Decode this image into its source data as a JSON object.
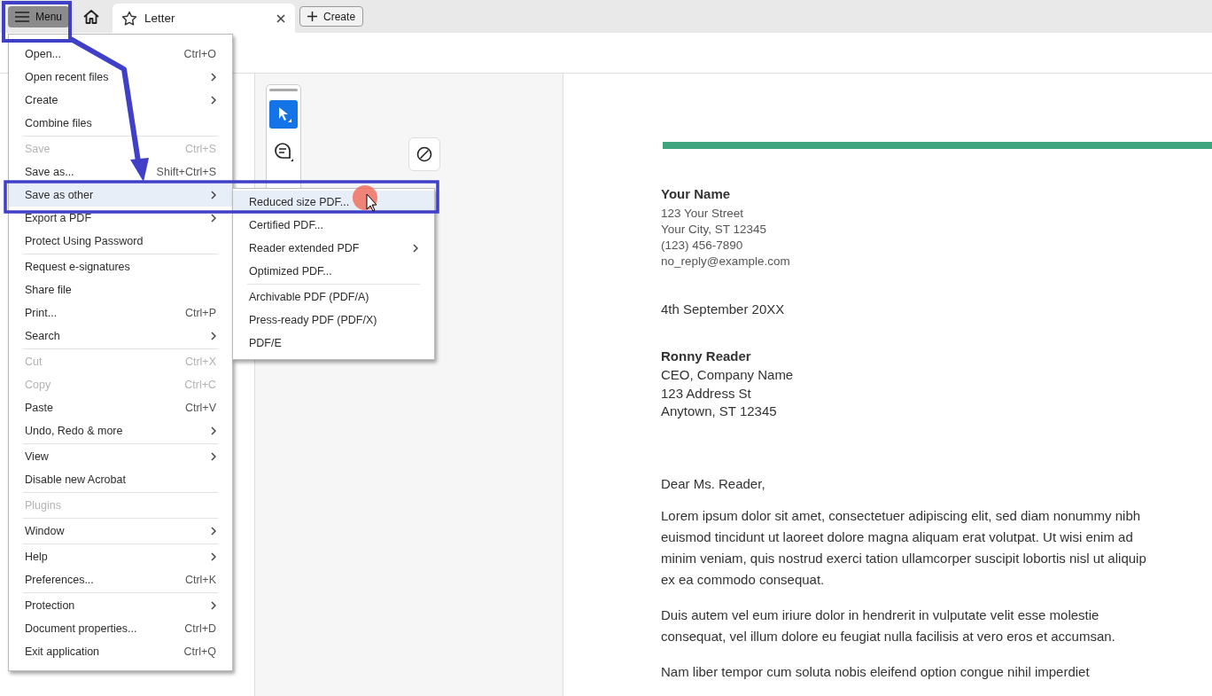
{
  "header": {
    "menu_button": "Menu",
    "tab": {
      "label": "Letter",
      "selected": true
    },
    "create_button": "Create"
  },
  "tools": [
    {
      "kind": "select",
      "selected": true
    },
    {
      "kind": "comment",
      "selected": false
    }
  ],
  "menu": {
    "groups": [
      {
        "items": [
          {
            "label": "Open...",
            "shortcut": "Ctrl+O",
            "submenu": false,
            "disabled": false,
            "selected": false
          },
          {
            "label": "Open recent files",
            "submenu": true,
            "disabled": false,
            "selected": false
          },
          {
            "label": "Create",
            "submenu": true,
            "disabled": false,
            "selected": false
          },
          {
            "label": "Combine files",
            "submenu": false,
            "disabled": false,
            "selected": false
          }
        ]
      },
      {
        "items": [
          {
            "label": "Save",
            "shortcut": "Ctrl+S",
            "submenu": false,
            "disabled": true,
            "selected": false
          },
          {
            "label": "Save as...",
            "shortcut": "Shift+Ctrl+S",
            "submenu": false,
            "disabled": false,
            "selected": false
          },
          {
            "label": "Save as other",
            "submenu": true,
            "disabled": false,
            "selected": true
          },
          {
            "label": "Export a PDF",
            "submenu": true,
            "disabled": false,
            "selected": false
          },
          {
            "label": "Protect Using Password",
            "submenu": false,
            "disabled": false,
            "selected": false
          }
        ]
      },
      {
        "items": [
          {
            "label": "Request e-signatures",
            "submenu": false,
            "disabled": false,
            "selected": false
          },
          {
            "label": "Share file",
            "submenu": false,
            "disabled": false,
            "selected": false
          },
          {
            "label": "Print...",
            "shortcut": "Ctrl+P",
            "submenu": false,
            "disabled": false,
            "selected": false
          },
          {
            "label": "Search",
            "submenu": true,
            "disabled": false,
            "selected": false
          }
        ]
      },
      {
        "items": [
          {
            "label": "Cut",
            "shortcut": "Ctrl+X",
            "submenu": false,
            "disabled": true,
            "selected": false
          },
          {
            "label": "Copy",
            "shortcut": "Ctrl+C",
            "submenu": false,
            "disabled": true,
            "selected": false
          },
          {
            "label": "Paste",
            "shortcut": "Ctrl+V",
            "submenu": false,
            "disabled": false,
            "selected": false
          },
          {
            "label": "Undo, Redo & more",
            "submenu": true,
            "disabled": false,
            "selected": false
          }
        ]
      },
      {
        "items": [
          {
            "label": "View",
            "submenu": true,
            "disabled": false,
            "selected": false
          },
          {
            "label": "Disable new Acrobat",
            "submenu": false,
            "disabled": false,
            "selected": false
          }
        ]
      },
      {
        "items": [
          {
            "label": "Plugins",
            "submenu": false,
            "disabled": true,
            "selected": false
          }
        ]
      },
      {
        "items": [
          {
            "label": "Window",
            "submenu": true,
            "disabled": false,
            "selected": false
          }
        ]
      },
      {
        "items": [
          {
            "label": "Help",
            "submenu": true,
            "disabled": false,
            "selected": false
          },
          {
            "label": "Preferences...",
            "shortcut": "Ctrl+K",
            "submenu": false,
            "disabled": false,
            "selected": false
          }
        ]
      },
      {
        "items": [
          {
            "label": "Protection",
            "submenu": true,
            "disabled": false,
            "selected": false
          },
          {
            "label": "Document properties...",
            "shortcut": "Ctrl+D",
            "submenu": false,
            "disabled": false,
            "selected": false
          },
          {
            "label": "Exit application",
            "shortcut": "Ctrl+Q",
            "submenu": false,
            "disabled": false,
            "selected": false
          }
        ]
      }
    ]
  },
  "submenu": {
    "groups": [
      {
        "items": [
          {
            "label": "Reduced size PDF...",
            "submenu": false,
            "disabled": false,
            "selected": true
          },
          {
            "label": "Certified PDF...",
            "submenu": false,
            "disabled": false,
            "selected": false
          },
          {
            "label": "Reader extended PDF",
            "submenu": true,
            "disabled": false,
            "selected": false
          },
          {
            "label": "Optimized PDF...",
            "submenu": false,
            "disabled": false,
            "selected": false
          }
        ]
      },
      {
        "items": [
          {
            "label": "Archivable PDF (PDF/A)",
            "submenu": false,
            "disabled": false,
            "selected": false
          },
          {
            "label": "Press-ready PDF (PDF/X)",
            "submenu": false,
            "disabled": false,
            "selected": false
          },
          {
            "label": "PDF/E",
            "submenu": false,
            "disabled": false,
            "selected": false
          }
        ]
      }
    ]
  },
  "document": {
    "sender": {
      "name": "Your Name",
      "lines": [
        "123 Your Street",
        "Your City, ST 12345",
        "(123) 456-7890",
        "no_reply@example.com"
      ]
    },
    "date": "4th September 20XX",
    "recipient": {
      "name": "Ronny Reader",
      "lines": [
        "CEO, Company Name",
        "123 Address St",
        "Anytown, ST 12345"
      ]
    },
    "salutation": "Dear Ms. Reader,",
    "paragraphs": [
      "Lorem ipsum dolor sit amet, consectetuer adipiscing elit, sed diam nonummy nibh euismod tincidunt ut laoreet dolore magna aliquam erat volutpat. Ut wisi enim ad minim veniam, quis nostrud exerci tation ullamcorper suscipit lobortis nisl ut aliquip ex ea commodo consequat.",
      "Duis autem vel eum iriure dolor in hendrerit in vulputate velit esse molestie consequat, vel illum dolore eu feugiat nulla facilisis at vero eros et accumsan.",
      "Nam liber tempor cum soluta nobis eleifend option congue nihil imperdiet"
    ]
  }
}
